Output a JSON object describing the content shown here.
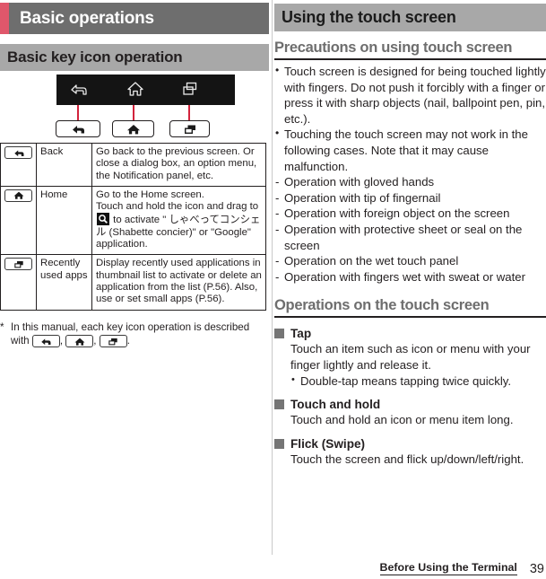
{
  "left": {
    "chapter_title": "Basic operations",
    "accent_color": "#e0576b",
    "chapter_bg": "#6e6e6e",
    "section_title": "Basic key icon operation",
    "section_bg": "#a8a8a8",
    "figure": {
      "name": "android-navigation-bar",
      "keys": [
        {
          "icon": "back-icon",
          "label": "Back"
        },
        {
          "icon": "home-icon",
          "label": "Home"
        },
        {
          "icon": "recent-apps-icon",
          "label": "Recently used apps"
        }
      ]
    },
    "table": {
      "rows": [
        {
          "icon": "back-icon",
          "name": "Back",
          "desc": "Go back to the previous screen. Or close a dialog box, an option menu, the Notification panel, etc."
        },
        {
          "icon": "home-icon",
          "name": "Home",
          "desc_1": "Go to the Home screen.",
          "desc_2": "Touch and hold the icon and drag to ",
          "desc_3": " to activate \" しゃべってコンシェル (Shabette concier)\" or \"Google\" application."
        },
        {
          "icon": "recent-apps-icon",
          "name": "Recently used apps",
          "desc": "Display recently used applications in thumbnail list to activate or delete an application from the list (P.56). Also, use or set small apps (P.56)."
        }
      ]
    },
    "footnote": {
      "marker": "*",
      "text_1": "In this manual, each key icon operation is described with ",
      "sep_1": ", ",
      "sep_2": ", ",
      "end": "."
    }
  },
  "right": {
    "band_title": "Using the touch screen",
    "band_bg": "#a8a8a8",
    "sub_head_1": "Precautions on using touch screen",
    "bullets": [
      "Touch screen is designed for being touched lightly with fingers. Do not push it forcibly with a finger or press it with sharp objects (nail, ballpoint pen, pin, etc.).",
      "Touching the touch screen may not work in the following cases. Note that it may cause malfunction."
    ],
    "dashes": [
      "Operation with gloved hands",
      "Operation with tip of fingernail",
      "Operation with foreign object on the screen",
      "Operation with protective sheet or seal on the screen",
      "Operation on the wet touch panel",
      "Operation with fingers wet with sweat or water"
    ],
    "sub_head_2": "Operations on the touch screen",
    "gestures": [
      {
        "title": "Tap",
        "body": "Touch an item such as icon or menu with your finger lightly and release it.",
        "sub": "Double-tap means tapping twice quickly."
      },
      {
        "title": "Touch and hold",
        "body": "Touch and hold an icon or menu item long."
      },
      {
        "title": "Flick (Swipe)",
        "body": "Touch the screen and flick up/down/left/right."
      }
    ]
  },
  "footer": {
    "title": "Before Using the Terminal",
    "page": "39"
  }
}
